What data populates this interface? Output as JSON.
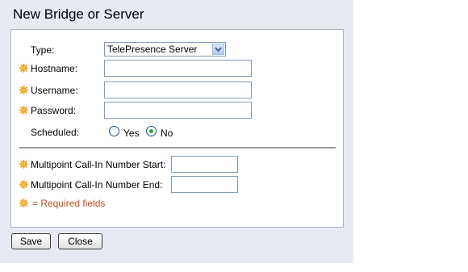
{
  "dialog": {
    "title": "New Bridge or Server"
  },
  "form": {
    "type": {
      "label": "Type:",
      "value": "TelePresence Server"
    },
    "hostname": {
      "label": "Hostname:",
      "value": "",
      "required": true
    },
    "username": {
      "label": "Username:",
      "value": "",
      "required": true
    },
    "password": {
      "label": "Password:",
      "value": "",
      "required": true
    },
    "scheduled": {
      "label": "Scheduled:",
      "options": [
        "Yes",
        "No"
      ],
      "selected": "No"
    },
    "callin_start": {
      "label": "Multipoint Call-In Number Start:",
      "value": "",
      "required": true
    },
    "callin_end": {
      "label": "Multipoint Call-In Number End:",
      "value": "",
      "required": true
    },
    "required_note": "= Required fields"
  },
  "buttons": {
    "save": "Save",
    "close": "Close"
  },
  "colors": {
    "dialog_bg": "#e8eaf3",
    "required_icon": "#f0a020",
    "required_text": "#c0501e",
    "radio_checked": "#2aa12e"
  },
  "icons": {
    "required": "asterisk-sun-icon",
    "dropdown": "chevron-down-icon"
  }
}
